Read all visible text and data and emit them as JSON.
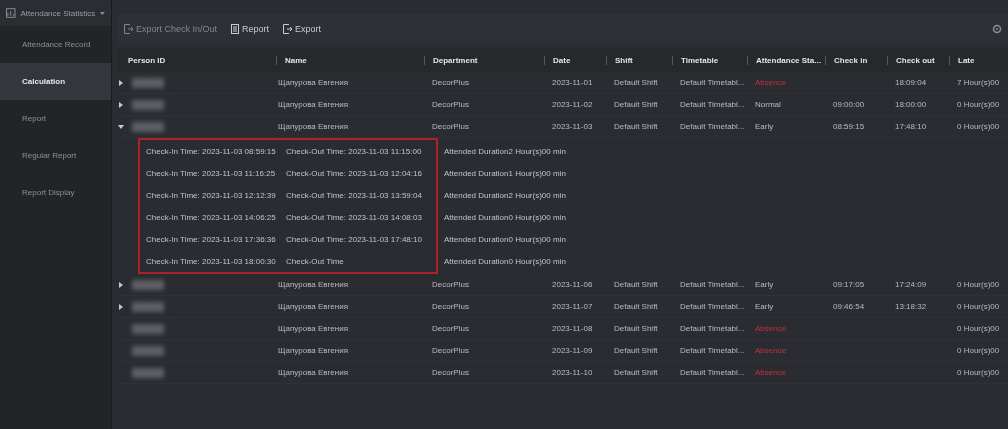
{
  "sidebar": {
    "title": "Attendance Statistics",
    "items": [
      {
        "label": "Attendance Record",
        "selected": false
      },
      {
        "label": "Calculation",
        "selected": true
      },
      {
        "label": "Report",
        "selected": false
      },
      {
        "label": "Regular Report",
        "selected": false
      },
      {
        "label": "Report Display",
        "selected": false
      }
    ]
  },
  "toolbar": [
    {
      "label": "Export Check In/Out",
      "disabled": true,
      "kind": "export"
    },
    {
      "label": "Report",
      "disabled": false,
      "kind": "report"
    },
    {
      "label": "Export",
      "disabled": false,
      "kind": "export"
    }
  ],
  "table": {
    "columns": [
      "Person ID",
      "Name",
      "Department",
      "Date",
      "Shift",
      "Timetable",
      "Attendance Sta...",
      "Check in",
      "Check out",
      "Late"
    ],
    "rows": [
      {
        "kind": "expandable",
        "expanded": false,
        "name": "Щапурова Евгения",
        "department": "DecorPlus",
        "date": "2023-11-01",
        "shift": "Default Shift",
        "timetable": "Default Timetabl...",
        "status": "Absence",
        "alert": true,
        "check_in": "",
        "check_out": "18:09:04",
        "late": "7 Hour(s)00"
      },
      {
        "kind": "expandable",
        "expanded": false,
        "name": "Щапурова Евгения",
        "department": "DecorPlus",
        "date": "2023-11-02",
        "shift": "Default Shift",
        "timetable": "Default Timetabl...",
        "status": "Normal",
        "alert": false,
        "check_in": "09:00:00",
        "check_out": "18:00:00",
        "late": "0 Hour(s)00"
      },
      {
        "kind": "expandable",
        "expanded": true,
        "name": "Щапурова Евгения",
        "department": "DecorPlus",
        "date": "2023-11-03",
        "shift": "Default Shift",
        "timetable": "Default Timetabl...",
        "status": "Early",
        "alert": false,
        "check_in": "08:59:15",
        "check_out": "17:48:10",
        "late": "0 Hour(s)00",
        "details": [
          {
            "check_in": "Check-In Time: 2023-11-03 08:59:15",
            "check_out": "Check-Out Time: 2023-11-03 11:15:00",
            "duration": "Attended Duration2 Hour(s)00 min"
          },
          {
            "check_in": "Check-In Time: 2023-11-03 11:16:25",
            "check_out": "Check-Out Time: 2023-11-03 12:04:16",
            "duration": "Attended Duration1 Hour(s)00 min"
          },
          {
            "check_in": "Check-In Time: 2023-11-03 12:12:39",
            "check_out": "Check-Out Time: 2023-11-03 13:59:04",
            "duration": "Attended Duration2 Hour(s)00 min"
          },
          {
            "check_in": "Check-In Time: 2023-11-03 14:06:25",
            "check_out": "Check-Out Time: 2023-11-03 14:08:03",
            "duration": "Attended Duration0 Hour(s)00 min"
          },
          {
            "check_in": "Check-In Time: 2023-11-03 17:36:36",
            "check_out": "Check-Out Time: 2023-11-03 17:48:10",
            "duration": "Attended Duration0 Hour(s)00 min"
          },
          {
            "check_in": "Check-In Time: 2023-11-03 18:00:30",
            "check_out": "Check-Out Time",
            "duration": "Attended Duration0 Hour(s)00 min"
          }
        ]
      },
      {
        "kind": "expandable",
        "expanded": false,
        "name": "Щапурова Евгения",
        "department": "DecorPlus",
        "date": "2023-11-06",
        "shift": "Default Shift",
        "timetable": "Default Timetabl...",
        "status": "Early",
        "alert": false,
        "check_in": "09:17:05",
        "check_out": "17:24:09",
        "late": "0 Hour(s)00"
      },
      {
        "kind": "expandable",
        "expanded": false,
        "name": "Щапурова Евгения",
        "department": "DecorPlus",
        "date": "2023-11-07",
        "shift": "Default Shift",
        "timetable": "Default Timetabl...",
        "status": "Early",
        "alert": false,
        "check_in": "09:46:54",
        "check_out": "13:18:32",
        "late": "0 Hour(s)00"
      },
      {
        "kind": "plain",
        "name": "Щапурова Евгения",
        "department": "DecorPlus",
        "date": "2023-11-08",
        "shift": "Default Shift",
        "timetable": "Default Timetabl...",
        "status": "Absence",
        "alert": true,
        "check_in": "",
        "check_out": "",
        "late": "0 Hour(s)00"
      },
      {
        "kind": "plain",
        "name": "Щапурова Евгения",
        "department": "DecorPlus",
        "date": "2023-11-09",
        "shift": "Default Shift",
        "timetable": "Default Timetabl...",
        "status": "Absence",
        "alert": true,
        "check_in": "",
        "check_out": "",
        "late": "0 Hour(s)00"
      },
      {
        "kind": "plain",
        "name": "Щапурова Евгения",
        "department": "DecorPlus",
        "date": "2023-11-10",
        "shift": "Default Shift",
        "timetable": "Default Timetabl...",
        "status": "Absence",
        "alert": true,
        "check_in": "",
        "check_out": "",
        "late": "0 Hour(s)00"
      }
    ]
  }
}
